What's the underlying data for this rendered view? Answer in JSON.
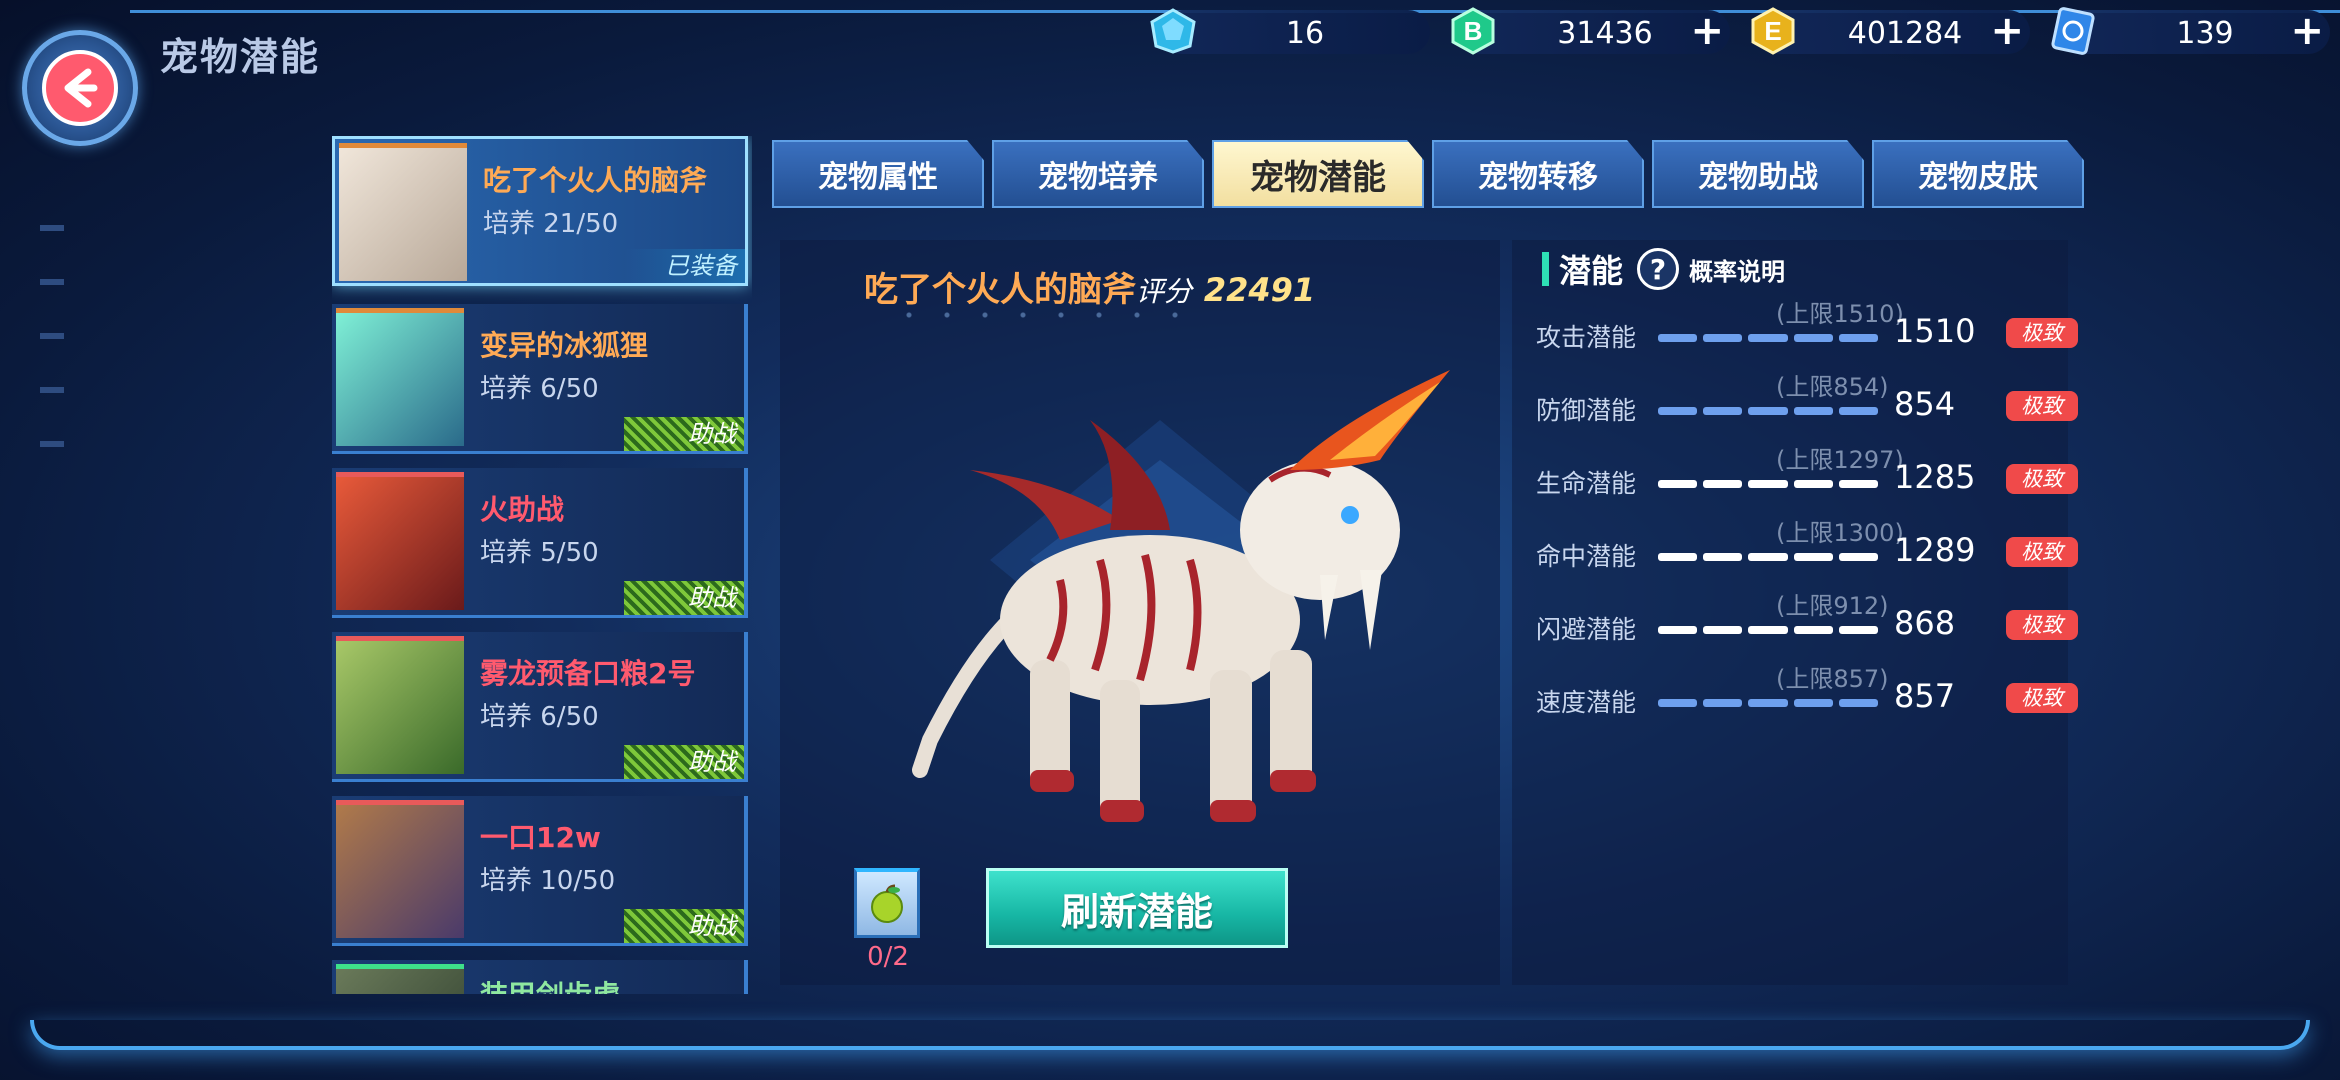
{
  "header": {
    "title": "宠物潜能"
  },
  "currencies": [
    {
      "icon": "diamond-icon",
      "value": "16",
      "has_plus": false,
      "color": "#2fb8e8"
    },
    {
      "icon": "b-coin-icon",
      "value": "31436",
      "has_plus": true,
      "color": "#1fc98a",
      "letter": "B"
    },
    {
      "icon": "e-coin-icon",
      "value": "401284",
      "has_plus": true,
      "color": "#e8b21c",
      "letter": "E"
    },
    {
      "icon": "ticket-icon",
      "value": "139",
      "has_plus": true,
      "color": "#2f86e8"
    }
  ],
  "pets": [
    {
      "name": "吃了个火人的脑斧",
      "train": "培养 21/50",
      "tag": "已装备",
      "name_color": "#ffaa55",
      "thumb_color": "#d9cfc2",
      "active": true
    },
    {
      "name": "变异的冰狐狸",
      "train": "培养 6/50",
      "tag": "助战",
      "name_color": "#ffaa55",
      "thumb_color": "#3fa7a6"
    },
    {
      "name": "火助战",
      "train": "培养 5/50",
      "tag": "助战",
      "name_color": "#ff5a6e",
      "thumb_color": "#b33a2c"
    },
    {
      "name": "雾龙预备口粮2号",
      "train": "培养 6/50",
      "tag": "助战",
      "name_color": "#ff5a6e",
      "thumb_color": "#5e8f3a"
    },
    {
      "name": "一口12w",
      "train": "培养 10/50",
      "tag": "助战",
      "name_color": "#ff5a6e",
      "thumb_color": "#5a4a6a"
    },
    {
      "name": "装甲剑齿虎",
      "train": "",
      "tag": "",
      "name_color": "#8fe8a0",
      "thumb_color": "#4a5a3a"
    }
  ],
  "tabs": [
    {
      "label": "宠物属性"
    },
    {
      "label": "宠物培养"
    },
    {
      "label": "宠物潜能",
      "active": true
    },
    {
      "label": "宠物转移"
    },
    {
      "label": "宠物助战"
    },
    {
      "label": "宠物皮肤"
    }
  ],
  "main": {
    "pet_name": "吃了个火人的脑斧",
    "score_label": "评分",
    "score": "22491",
    "item_count": "0/2",
    "refresh_label": "刷新潜能"
  },
  "potential": {
    "title": "潜能",
    "help": "?",
    "prob_label": "概率说明",
    "stats": [
      {
        "label": "攻击潜能",
        "cap": "(上限1510)",
        "value": "1510",
        "badge": "极致",
        "fill": 1.0,
        "style": "blue"
      },
      {
        "label": "防御潜能",
        "cap": "(上限854)",
        "value": "854",
        "badge": "极致",
        "fill": 1.0,
        "style": "blue"
      },
      {
        "label": "生命潜能",
        "cap": "(上限1297)",
        "value": "1285",
        "badge": "极致",
        "fill": 0.99,
        "style": "white"
      },
      {
        "label": "命中潜能",
        "cap": "(上限1300)",
        "value": "1289",
        "badge": "极致",
        "fill": 0.99,
        "style": "white"
      },
      {
        "label": "闪避潜能",
        "cap": "(上限912)",
        "value": "868",
        "badge": "极致",
        "fill": 0.95,
        "style": "white"
      },
      {
        "label": "速度潜能",
        "cap": "(上限857)",
        "value": "857",
        "badge": "极致",
        "fill": 1.0,
        "style": "blue"
      }
    ]
  }
}
